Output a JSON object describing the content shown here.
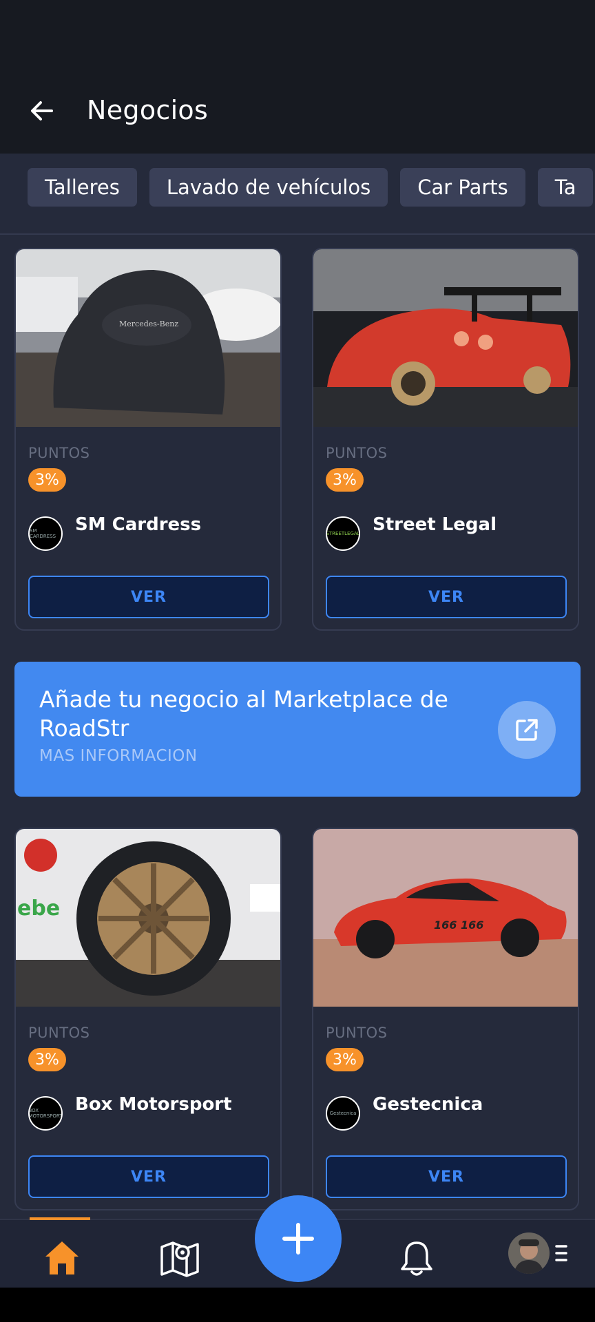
{
  "header": {
    "title": "Negocios"
  },
  "categories": [
    "Talleres",
    "Lavado de vehículos",
    "Car Parts",
    "Ta"
  ],
  "businesses": [
    {
      "points_label": "PUNTOS",
      "points": "3%",
      "name": "SM Cardress",
      "logo_text": "SM CARDRESS",
      "button": "VER"
    },
    {
      "points_label": "PUNTOS",
      "points": "3%",
      "name": "Street Legal",
      "logo_text": "STREETLEGAL",
      "button": "VER"
    },
    {
      "points_label": "PUNTOS",
      "points": "3%",
      "name": "Box Motorsport",
      "logo_text": "BOX MOTORSPORT",
      "button": "VER"
    },
    {
      "points_label": "PUNTOS",
      "points": "3%",
      "name": "Gestecnica",
      "logo_text": "Gestecnica",
      "button": "VER"
    }
  ],
  "promo": {
    "title": "Añade tu negocio al Marketplace de RoadStr",
    "subtitle": "MAS INFORMACION"
  },
  "nav": {
    "items": [
      "home-icon",
      "map-icon",
      "add-icon",
      "bell-icon",
      "avatar",
      "menu-icon"
    ],
    "active": "home"
  },
  "colors": {
    "accent": "#3d86f5",
    "badge": "#f7922a",
    "background": "#252a3b",
    "header": "#171a21"
  }
}
